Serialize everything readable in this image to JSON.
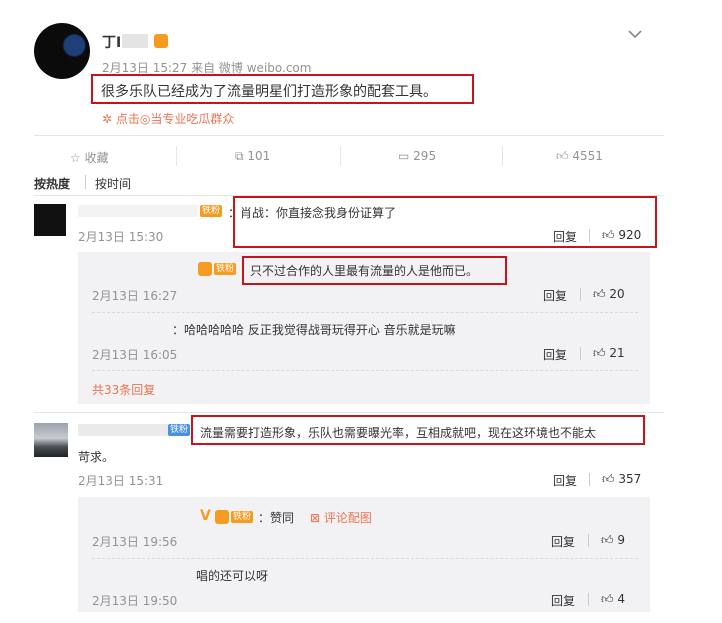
{
  "post": {
    "author_name": "丁I",
    "meta": "2月13日 15:27 来自 微博 weibo.com",
    "text": "很多乐队已经成为了流量明星们打造形象的配套工具。",
    "link_text": "点击◎当专业吃瓜群众"
  },
  "actions": {
    "collect_label": "收藏",
    "forward_count": "101",
    "comment_count": "295",
    "like_count": "4551"
  },
  "sort": {
    "hot_label": "按热度",
    "time_label": "按时间"
  },
  "comments": [
    {
      "badge": "铁粉",
      "text": "：肖战：你直接念我身份证算了",
      "time": "2月13日 15:30",
      "reply_label": "回复",
      "likes": "920",
      "replies": [
        {
          "badge": "铁粉",
          "text": "只不过合作的人里最有流量的人是他而已。",
          "time": "2月13日 16:27",
          "reply_label": "回复",
          "likes": "20"
        },
        {
          "text": "：哈哈哈哈哈 反正我觉得战哥玩得开心 音乐就是玩嘛",
          "time": "2月13日 16:05",
          "reply_label": "回复",
          "likes": "21"
        }
      ],
      "more_replies": "共33条回复"
    },
    {
      "badge": "铁粉",
      "text": "流量需要打造形象，乐队也需要曝光率，互相成就吧，现在这环境也不能太",
      "text_cont": "苛求。",
      "time": "2月13日 15:31",
      "reply_label": "回复",
      "likes": "357",
      "replies": [
        {
          "badge": "铁粉",
          "text": "：赞同",
          "pic_label": "评论配图",
          "time": "2月13日 19:56",
          "reply_label": "回复",
          "likes": "9"
        },
        {
          "text": "唱的还可以呀",
          "time": "2月13日 19:50",
          "reply_label": "回复",
          "likes": "4"
        }
      ]
    }
  ],
  "colors": {
    "highlight_box": "#c3161c",
    "link": "#eb7350",
    "muted": "#939393"
  }
}
